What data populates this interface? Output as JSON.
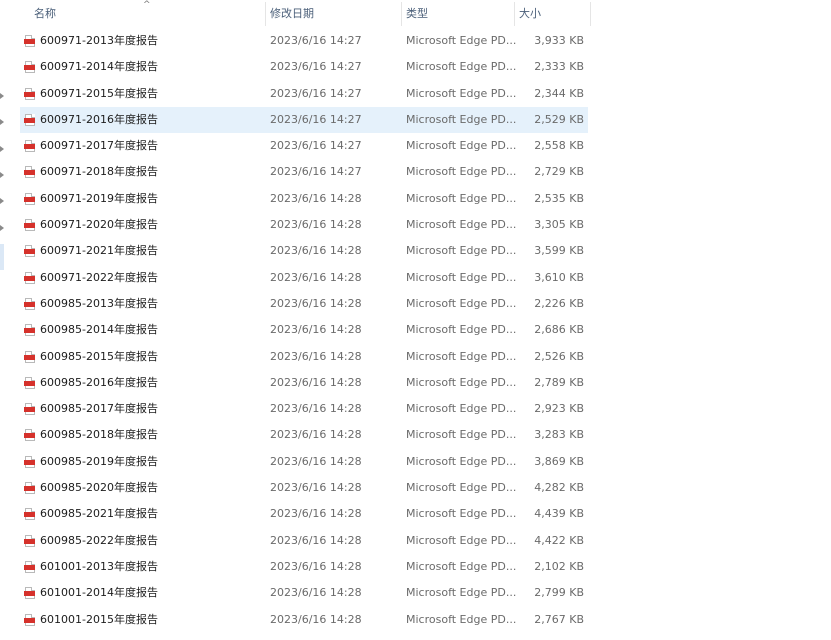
{
  "columns": {
    "name": "名称",
    "date": "修改日期",
    "type": "类型",
    "size": "大小"
  },
  "sort_indicator": "^",
  "selected_row_index": 3,
  "file_icon": "pdf-file-icon",
  "files": [
    {
      "name": "600971-2013年度报告",
      "date": "2023/6/16 14:27",
      "type": "Microsoft Edge PD...",
      "size": "3,933 KB"
    },
    {
      "name": "600971-2014年度报告",
      "date": "2023/6/16 14:27",
      "type": "Microsoft Edge PD...",
      "size": "2,333 KB"
    },
    {
      "name": "600971-2015年度报告",
      "date": "2023/6/16 14:27",
      "type": "Microsoft Edge PD...",
      "size": "2,344 KB"
    },
    {
      "name": "600971-2016年度报告",
      "date": "2023/6/16 14:27",
      "type": "Microsoft Edge PD...",
      "size": "2,529 KB"
    },
    {
      "name": "600971-2017年度报告",
      "date": "2023/6/16 14:27",
      "type": "Microsoft Edge PD...",
      "size": "2,558 KB"
    },
    {
      "name": "600971-2018年度报告",
      "date": "2023/6/16 14:27",
      "type": "Microsoft Edge PD...",
      "size": "2,729 KB"
    },
    {
      "name": "600971-2019年度报告",
      "date": "2023/6/16 14:28",
      "type": "Microsoft Edge PD...",
      "size": "2,535 KB"
    },
    {
      "name": "600971-2020年度报告",
      "date": "2023/6/16 14:28",
      "type": "Microsoft Edge PD...",
      "size": "3,305 KB"
    },
    {
      "name": "600971-2021年度报告",
      "date": "2023/6/16 14:28",
      "type": "Microsoft Edge PD...",
      "size": "3,599 KB"
    },
    {
      "name": "600971-2022年度报告",
      "date": "2023/6/16 14:28",
      "type": "Microsoft Edge PD...",
      "size": "3,610 KB"
    },
    {
      "name": "600985-2013年度报告",
      "date": "2023/6/16 14:28",
      "type": "Microsoft Edge PD...",
      "size": "2,226 KB"
    },
    {
      "name": "600985-2014年度报告",
      "date": "2023/6/16 14:28",
      "type": "Microsoft Edge PD...",
      "size": "2,686 KB"
    },
    {
      "name": "600985-2015年度报告",
      "date": "2023/6/16 14:28",
      "type": "Microsoft Edge PD...",
      "size": "2,526 KB"
    },
    {
      "name": "600985-2016年度报告",
      "date": "2023/6/16 14:28",
      "type": "Microsoft Edge PD...",
      "size": "2,789 KB"
    },
    {
      "name": "600985-2017年度报告",
      "date": "2023/6/16 14:28",
      "type": "Microsoft Edge PD...",
      "size": "2,923 KB"
    },
    {
      "name": "600985-2018年度报告",
      "date": "2023/6/16 14:28",
      "type": "Microsoft Edge PD...",
      "size": "3,283 KB"
    },
    {
      "name": "600985-2019年度报告",
      "date": "2023/6/16 14:28",
      "type": "Microsoft Edge PD...",
      "size": "3,869 KB"
    },
    {
      "name": "600985-2020年度报告",
      "date": "2023/6/16 14:28",
      "type": "Microsoft Edge PD...",
      "size": "4,282 KB"
    },
    {
      "name": "600985-2021年度报告",
      "date": "2023/6/16 14:28",
      "type": "Microsoft Edge PD...",
      "size": "4,439 KB"
    },
    {
      "name": "600985-2022年度报告",
      "date": "2023/6/16 14:28",
      "type": "Microsoft Edge PD...",
      "size": "4,422 KB"
    },
    {
      "name": "601001-2013年度报告",
      "date": "2023/6/16 14:28",
      "type": "Microsoft Edge PD...",
      "size": "2,102 KB"
    },
    {
      "name": "601001-2014年度报告",
      "date": "2023/6/16 14:28",
      "type": "Microsoft Edge PD...",
      "size": "2,799 KB"
    },
    {
      "name": "601001-2015年度报告",
      "date": "2023/6/16 14:28",
      "type": "Microsoft Edge PD...",
      "size": "2,767 KB"
    }
  ]
}
